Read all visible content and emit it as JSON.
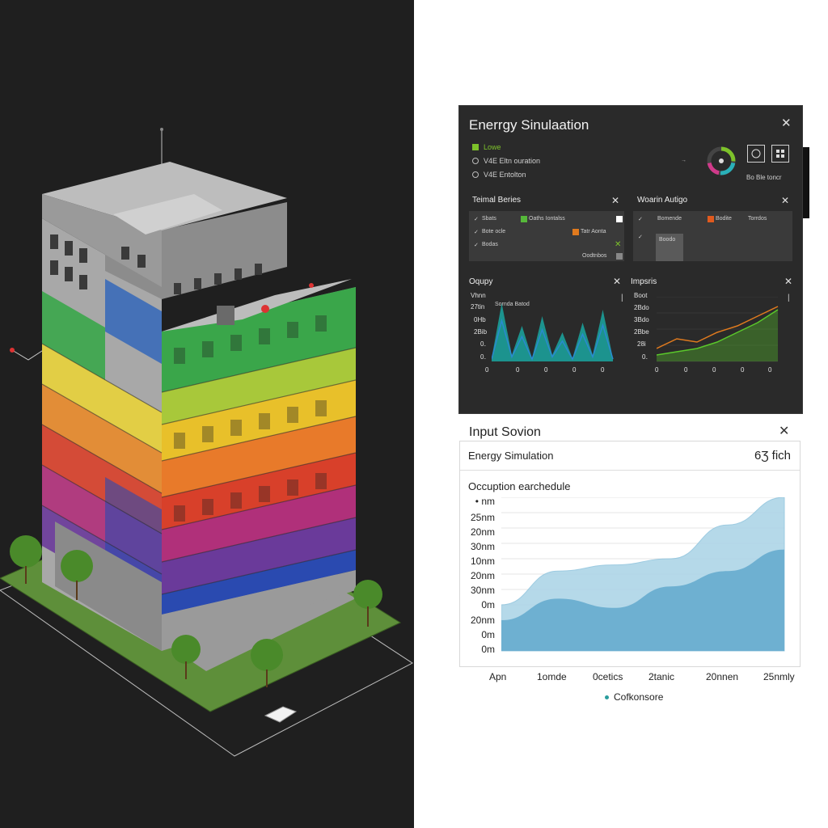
{
  "dark_panel": {
    "title": "Enerrgy Sinulaation",
    "legend": [
      {
        "label": "Lowe",
        "color": "#7dc22a"
      },
      {
        "label": "V4E Eltn ouration"
      },
      {
        "label": "V4E Entolton"
      }
    ],
    "controls_label": "Bo Ble toncr",
    "cards": {
      "thermal": {
        "title": "Teimal Beries",
        "rows": [
          {
            "left": "Sbats",
            "right": "Oaths Iontalss",
            "color": "#56b83a"
          },
          {
            "left": "Bote ocle",
            "right": "Tatr Aonta",
            "color": "#e07a1e"
          },
          {
            "left": "Bodas",
            "right": "",
            "mark": "✕"
          },
          {
            "left": "",
            "right": "Oodtnbos",
            "color": "#888888"
          }
        ]
      },
      "warming": {
        "title": "Woarin Autigo",
        "rows": [
          {
            "left": "Bomende",
            "right": "Bodite",
            "right2": "Torrdos",
            "color": "#e05a1e"
          },
          {
            "left": "",
            "right": "Boodo"
          }
        ]
      },
      "occupancy": {
        "title": "Oqupy",
        "chart_label": "Sornda Batod",
        "y_ticks": [
          "Vhnn",
          "27tin",
          "0Hb",
          "2Bib",
          "0․",
          "0․"
        ],
        "x_ticks": [
          "0",
          "0",
          "0",
          "0",
          "0"
        ]
      },
      "imports": {
        "title": "Impsris",
        "y_ticks": [
          "Boot",
          "2Bdo",
          "3Bdo",
          "2Bbe",
          "28i",
          "0․"
        ],
        "x_ticks": [
          "0",
          "0",
          "0",
          "0",
          "0"
        ]
      }
    }
  },
  "input_panel": {
    "title": "Input Sovion",
    "header_label": "Energy Simulation",
    "header_value": "6Ʒ fich",
    "chart_title": "Occuption earchedule",
    "y_ticks": [
      "• nm",
      "25nm",
      "20nm",
      "30nm",
      "10nm",
      "20nm",
      "30nm",
      "0m",
      "20nm",
      "0m",
      "0m"
    ],
    "x_ticks": [
      "Apn",
      "1omde",
      "0cetics",
      "2tanic",
      "20nnen",
      "25nmly"
    ],
    "legend_label": "Cofkonsore",
    "colors": {
      "front_area": "#6aaed0",
      "back_area": "#a9d3e6",
      "legend_dot": "#2a9d9d"
    }
  },
  "chart_data": [
    {
      "type": "area",
      "title": "Occuption earchedule",
      "x": [
        "Apn",
        "1omde",
        "0cetics",
        "2tanic",
        "20nnen",
        "25nmly"
      ],
      "series": [
        {
          "name": "",
          "values": [
            0.3,
            0.52,
            0.56,
            0.6,
            0.82,
            1.0
          ]
        },
        {
          "name": "Cofkonsore",
          "values": [
            0.2,
            0.34,
            0.28,
            0.42,
            0.52,
            0.66
          ]
        }
      ]
    },
    {
      "type": "line",
      "title": "Oqupy",
      "series": [
        {
          "name": "",
          "values": [
            0.05,
            0.9,
            0.1,
            0.55,
            0.05,
            0.7,
            0.1,
            0.45,
            0.05,
            0.6,
            0.1,
            0.8,
            0.05
          ]
        }
      ]
    },
    {
      "type": "line",
      "title": "Impsris",
      "series": [
        {
          "name": "",
          "values": [
            0.2,
            0.35,
            0.3,
            0.45,
            0.55,
            0.7,
            0.85
          ]
        },
        {
          "name": "",
          "values": [
            0.1,
            0.15,
            0.2,
            0.3,
            0.45,
            0.6,
            0.8
          ]
        }
      ]
    }
  ]
}
